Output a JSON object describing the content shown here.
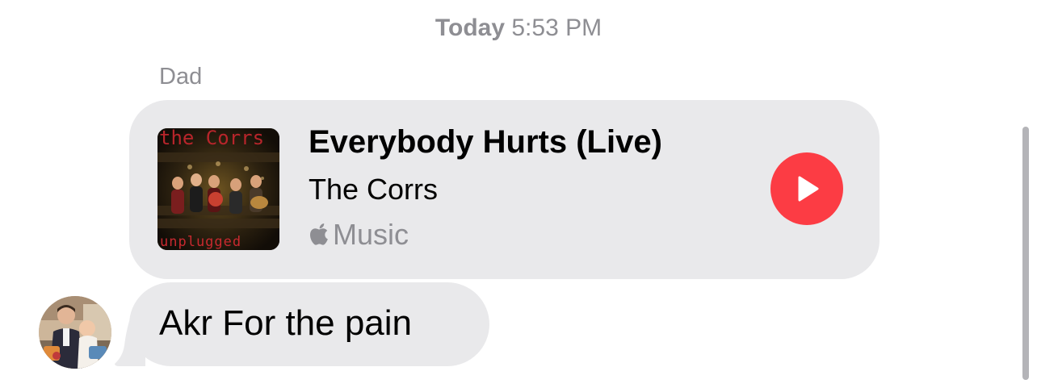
{
  "timestamp": {
    "day": "Today",
    "time": "5:53 PM"
  },
  "sender_name": "Dad",
  "music_card": {
    "title": "Everybody Hurts (Live)",
    "artist": "The Corrs",
    "service": "Music",
    "service_icon": "apple-logo-icon",
    "album_art_text_top": "the Corrs",
    "album_art_text_bottom": "unplugged",
    "play_button_color": "#fc3c44"
  },
  "message": {
    "text": "Akr For the pain"
  },
  "colors": {
    "bubble_background": "#e9e9eb",
    "secondary_text": "#8e8e93",
    "primary_text": "#000000"
  }
}
